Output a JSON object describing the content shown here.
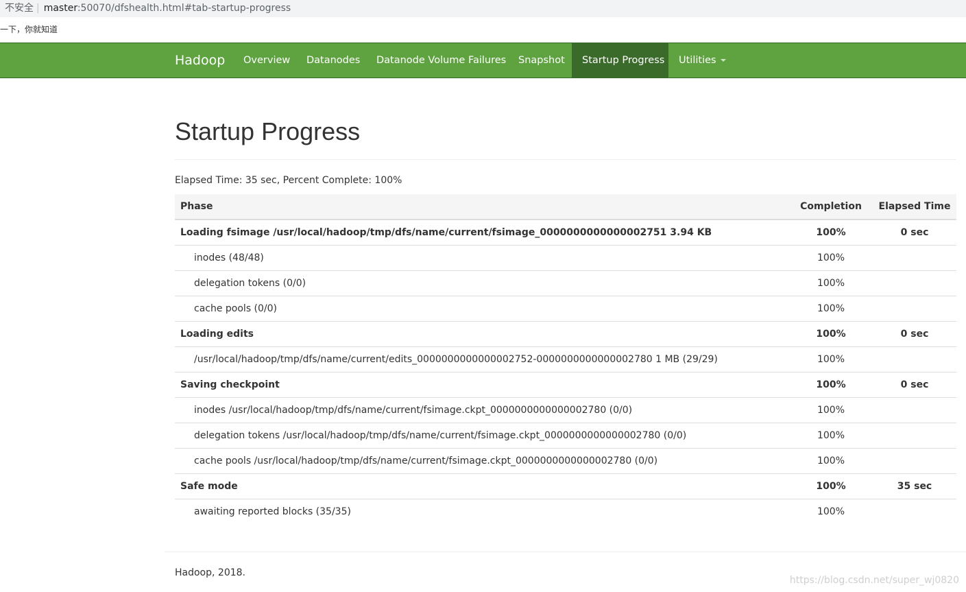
{
  "browser": {
    "security_label": "不安全",
    "separator": "|",
    "host": "master",
    "path": ":50070/dfshealth.html#tab-startup-progress",
    "bookmark": "一下，你就知道"
  },
  "navbar": {
    "brand": "Hadoop",
    "items": [
      {
        "label": "Overview"
      },
      {
        "label": "Datanodes"
      },
      {
        "label": "Datanode Volume Failures"
      },
      {
        "label": "Snapshot"
      },
      {
        "label": "Startup Progress",
        "active": true
      },
      {
        "label": "Utilities",
        "dropdown": true
      }
    ],
    "color": "#5fa341",
    "active_color": "#3b6b2a"
  },
  "page": {
    "title": "Startup Progress",
    "elapsed": "Elapsed Time: 35 sec, Percent Complete: 100%"
  },
  "table": {
    "headers": {
      "phase": "Phase",
      "completion": "Completion",
      "elapsed": "Elapsed Time"
    },
    "rows": [
      {
        "type": "phase",
        "name": "Loading fsimage /usr/local/hadoop/tmp/dfs/name/current/fsimage_0000000000000002751 3.94 KB",
        "completion": "100%",
        "elapsed": "0 sec"
      },
      {
        "type": "step",
        "name": "inodes (48/48)",
        "completion": "100%",
        "elapsed": ""
      },
      {
        "type": "step",
        "name": "delegation tokens (0/0)",
        "completion": "100%",
        "elapsed": ""
      },
      {
        "type": "step",
        "name": "cache pools (0/0)",
        "completion": "100%",
        "elapsed": ""
      },
      {
        "type": "phase",
        "name": "Loading edits",
        "completion": "100%",
        "elapsed": "0 sec"
      },
      {
        "type": "step",
        "name": "/usr/local/hadoop/tmp/dfs/name/current/edits_0000000000000002752-0000000000000002780 1 MB (29/29)",
        "completion": "100%",
        "elapsed": ""
      },
      {
        "type": "phase",
        "name": "Saving checkpoint",
        "completion": "100%",
        "elapsed": "0 sec"
      },
      {
        "type": "step",
        "name": "inodes /usr/local/hadoop/tmp/dfs/name/current/fsimage.ckpt_0000000000000002780 (0/0)",
        "completion": "100%",
        "elapsed": ""
      },
      {
        "type": "step",
        "name": "delegation tokens /usr/local/hadoop/tmp/dfs/name/current/fsimage.ckpt_0000000000000002780 (0/0)",
        "completion": "100%",
        "elapsed": ""
      },
      {
        "type": "step",
        "name": "cache pools /usr/local/hadoop/tmp/dfs/name/current/fsimage.ckpt_0000000000000002780 (0/0)",
        "completion": "100%",
        "elapsed": ""
      },
      {
        "type": "phase",
        "name": "Safe mode",
        "completion": "100%",
        "elapsed": "35 sec"
      },
      {
        "type": "step",
        "name": "awaiting reported blocks (35/35)",
        "completion": "100%",
        "elapsed": ""
      }
    ]
  },
  "footer": {
    "text": "Hadoop, 2018.",
    "watermark": "https://blog.csdn.net/super_wj0820"
  }
}
